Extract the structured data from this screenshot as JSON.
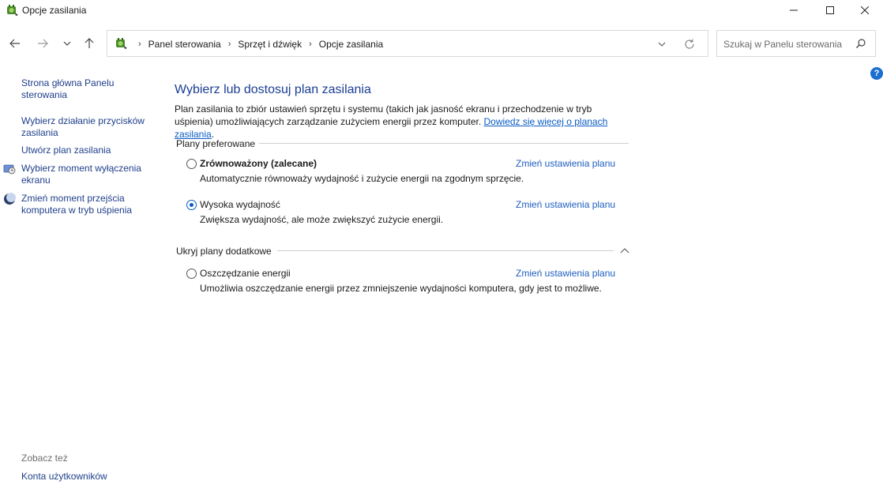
{
  "window": {
    "title": "Opcje zasilania"
  },
  "nav": {
    "breadcrumbs": [
      "Panel sterowania",
      "Sprzęt i dźwięk",
      "Opcje zasilania"
    ],
    "search_placeholder": "Szukaj w Panelu sterowania"
  },
  "left_pane": {
    "links": [
      "Strona główna Panelu sterowania",
      "Wybierz działanie przycisków zasilania",
      "Utwórz plan zasilania",
      "Wybierz moment wyłączenia ekranu",
      "Zmień moment przejścia komputera w tryb uśpienia"
    ],
    "see_also_label": "Zobacz też",
    "see_also_links": [
      "Konta użytkowników"
    ]
  },
  "main": {
    "title": "Wybierz lub dostosuj plan zasilania",
    "description": "Plan zasilania to zbiór ustawień sprzętu i systemu (takich jak jasność ekranu i przechodzenie w tryb uśpienia) umożliwiających zarządzanie zużyciem energii przez komputer.",
    "learn_more_link": "Dowiedz się więcej o planach zasilania",
    "preferred_header": "Plany preferowane",
    "additional_header": "Ukryj plany dodatkowe",
    "change_settings_label": "Zmień ustawienia planu",
    "plans": [
      {
        "name": "Zrównoważony (zalecane)",
        "description": "Automatycznie równoważy wydajność i zużycie energii na zgodnym sprzęcie.",
        "selected": false,
        "bold": true
      },
      {
        "name": "Wysoka wydajność",
        "description": "Zwiększa wydajność, ale może zwiększyć zużycie energii.",
        "selected": true,
        "bold": false
      },
      {
        "name": "Oszczędzanie energii",
        "description": "Umożliwia oszczędzanie energii przez zmniejszenie wydajności komputera, gdy jest to możliwe.",
        "selected": false,
        "bold": false
      }
    ]
  },
  "colors": {
    "link": "#1f3f8a",
    "accent": "#0a5bc4",
    "title": "#1a3d94",
    "help": "#1a6fd1"
  },
  "icons": {
    "app": "power-options-icon",
    "help": "help-icon"
  }
}
